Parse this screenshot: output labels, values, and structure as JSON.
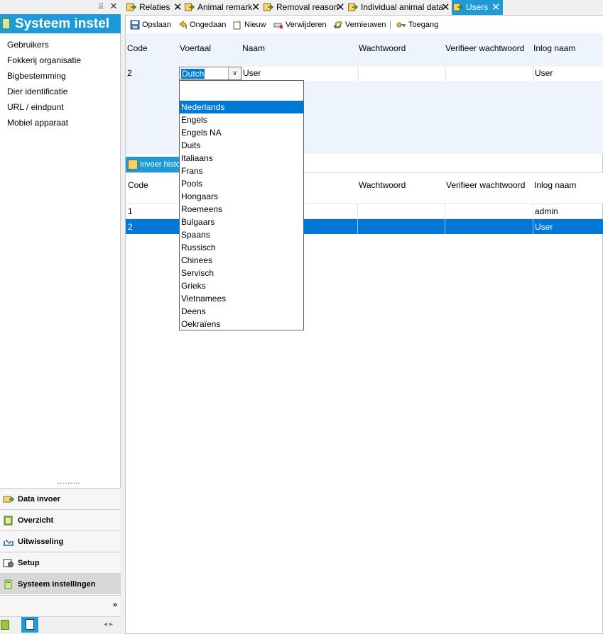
{
  "left_panel": {
    "title": "Systeem instel",
    "pin_glyph": "⍓",
    "close_glyph": "✕",
    "items": [
      {
        "label": "Gebruikers"
      },
      {
        "label": "Fokkerij organisatie"
      },
      {
        "label": "Bigbestemming"
      },
      {
        "label": "Dier identificatie"
      },
      {
        "label": "URL / eindpunt"
      },
      {
        "label": "Mobiel apparaat"
      }
    ],
    "dots": "………",
    "sections": [
      {
        "label": "Data invoer",
        "icon": "data-entry-icon"
      },
      {
        "label": "Overzicht",
        "icon": "overview-icon"
      },
      {
        "label": "Uitwisseling",
        "icon": "exchange-icon"
      },
      {
        "label": "Setup",
        "icon": "setup-icon"
      },
      {
        "label": "Systeem instellingen",
        "icon": "system-settings-icon"
      }
    ],
    "more_glyph": "»",
    "nav_arrows": "◂▸"
  },
  "tabs": [
    {
      "label": "Relaties",
      "close": "✕"
    },
    {
      "label": "Animal remark",
      "close": "✕"
    },
    {
      "label": "Removal reason",
      "close": "✕"
    },
    {
      "label": "Individual animal data",
      "close": "✕"
    },
    {
      "label": "Users",
      "close": "✕"
    }
  ],
  "toolbar": {
    "save": "Opslaan",
    "undo": "Ongedaan",
    "new": "Nieuw",
    "delete": "Verwijderen",
    "refresh": "Vernieuwen",
    "access": "Toegang"
  },
  "form": {
    "headers": {
      "code": "Code",
      "voertaal": "Voertaal",
      "naam": "Naam",
      "wachtwoord": "Wachtwoord",
      "verifieer": "Verifieer wachtwoord",
      "inlog": "Inlog naam"
    },
    "row": {
      "code": "2",
      "voertaal": "Dutch",
      "naam": "User",
      "inlog": "User"
    },
    "dropdown_arrow": "∨"
  },
  "history": {
    "bar_label": "Invoer historie",
    "headers": {
      "code": "Code",
      "wachtwoord": "Wachtwoord",
      "verifieer": "Verifieer wachtwoord",
      "inlog": "Inlog naam"
    },
    "rows": [
      {
        "code": "1",
        "inlog": "admin"
      },
      {
        "code": "2",
        "inlog": "User"
      }
    ]
  },
  "dropdown": {
    "selected": "Nederlands",
    "options": [
      "Nederlands",
      "Engels",
      "Engels NA",
      "Duits",
      "Italiaans",
      "Frans",
      "Pools",
      "Hongaars",
      "Roemeens",
      "Bulgaars",
      "Spaans",
      "Russisch",
      "Chinees",
      "Servisch",
      "Grieks",
      "Vietnamees",
      "Deens",
      "Oekraïens"
    ]
  },
  "colors": {
    "accent": "#1e9ad6",
    "selection": "#0078d7",
    "form_bg": "#eef4fb"
  }
}
